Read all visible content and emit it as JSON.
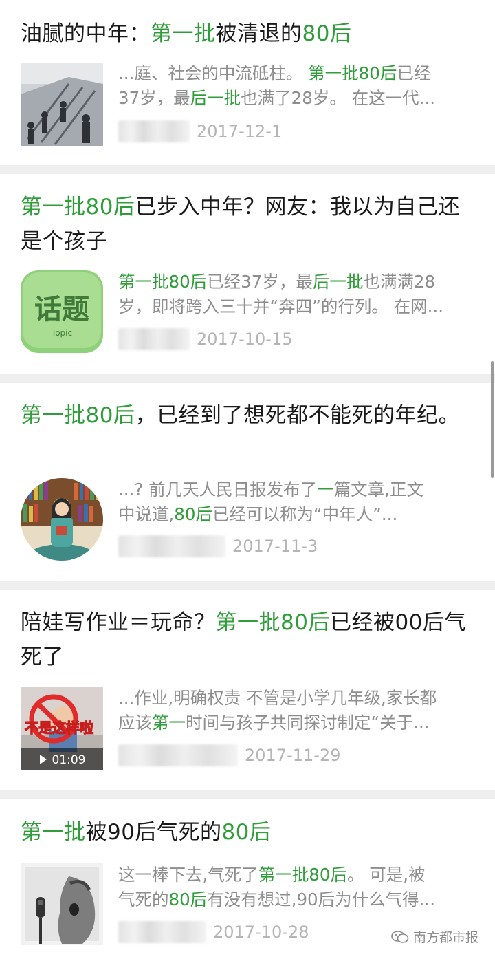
{
  "articles": [
    {
      "title_parts": [
        {
          "text": "油腻的中年：",
          "hl": false
        },
        {
          "text": "第一批",
          "hl": true
        },
        {
          "text": "被清退的",
          "hl": false
        },
        {
          "text": "80后",
          "hl": true
        }
      ],
      "snippet_lines": [
        [
          {
            "text": "...庭、社会的中流砥柱。 ",
            "hl": false
          },
          {
            "text": "第一批80后",
            "hl": true
          },
          {
            "text": "已经",
            "hl": false
          }
        ],
        [
          {
            "text": "37岁，最",
            "hl": false
          },
          {
            "text": "后一批",
            "hl": true
          },
          {
            "text": "也满了28岁。 在这一代...",
            "hl": false
          }
        ]
      ],
      "date": "2017-12-1",
      "thumb": "escalator-photo"
    },
    {
      "title_parts": [
        {
          "text": "第一批80后",
          "hl": true
        },
        {
          "text": "已步入中年？网友：我以为自己还是个孩子",
          "hl": false
        }
      ],
      "snippet_lines": [
        [
          {
            "text": "第一批80后",
            "hl": true
          },
          {
            "text": "已经37岁，最",
            "hl": false
          },
          {
            "text": "后一批",
            "hl": true
          },
          {
            "text": "也满满28",
            "hl": false
          }
        ],
        [
          {
            "text": "岁，即将跨入三十并“奔四”的行列。 在网...",
            "hl": false
          }
        ]
      ],
      "date": "2017-10-15",
      "thumb": "topic-badge",
      "thumb_label": "话题",
      "thumb_sublabel": "Topic"
    },
    {
      "title_parts": [
        {
          "text": "第一批80后",
          "hl": true
        },
        {
          "text": "，已经到了想死都不能死的年纪。",
          "hl": false
        }
      ],
      "snippet_lines": [
        [
          {
            "text": "...? 前几天人民日报发布了",
            "hl": false
          },
          {
            "text": "一",
            "hl": true
          },
          {
            "text": "篇文章,正文",
            "hl": false
          }
        ],
        [
          {
            "text": "中说道,",
            "hl": false
          },
          {
            "text": "80后",
            "hl": true
          },
          {
            "text": "已经可以称为“中年人”...",
            "hl": false
          }
        ]
      ],
      "date": "2017-11-3",
      "thumb": "illustration-bookshelf"
    },
    {
      "title_parts": [
        {
          "text": "陪娃写作业＝玩命？",
          "hl": false
        },
        {
          "text": "第一批80后",
          "hl": true
        },
        {
          "text": "已经被00后气死了",
          "hl": false
        }
      ],
      "snippet_lines": [
        [
          {
            "text": "...作业,明确权责 不管是小学几年级,家长都",
            "hl": false
          }
        ],
        [
          {
            "text": "应该",
            "hl": false
          },
          {
            "text": "第一",
            "hl": true
          },
          {
            "text": "时间与孩子共同探讨制定“关于...",
            "hl": false
          }
        ]
      ],
      "date": "2017-11-29",
      "thumb": "video-thumb",
      "thumb_caption": "不是这样啦",
      "video_duration": "01:09"
    },
    {
      "title_parts": [
        {
          "text": "第一批",
          "hl": true
        },
        {
          "text": "被90后气死的",
          "hl": false
        },
        {
          "text": "80后",
          "hl": true
        }
      ],
      "snippet_lines": [
        [
          {
            "text": "这一棒下去,气死了",
            "hl": false
          },
          {
            "text": "第一批80后",
            "hl": true
          },
          {
            "text": "。 可是,被",
            "hl": false
          }
        ],
        [
          {
            "text": "气死的",
            "hl": false
          },
          {
            "text": "80后",
            "hl": true
          },
          {
            "text": "有没有想过,90后为什么气得...",
            "hl": false
          }
        ]
      ],
      "date": "2017-10-28",
      "thumb": "bw-singer-photo"
    }
  ],
  "watermark": "南方都市报",
  "colors": {
    "highlight": "#2f9e3a",
    "title": "#1a1a1a",
    "snippet": "#8e8e8e",
    "date": "#b5b5b5",
    "separator": "#eeeeee"
  }
}
